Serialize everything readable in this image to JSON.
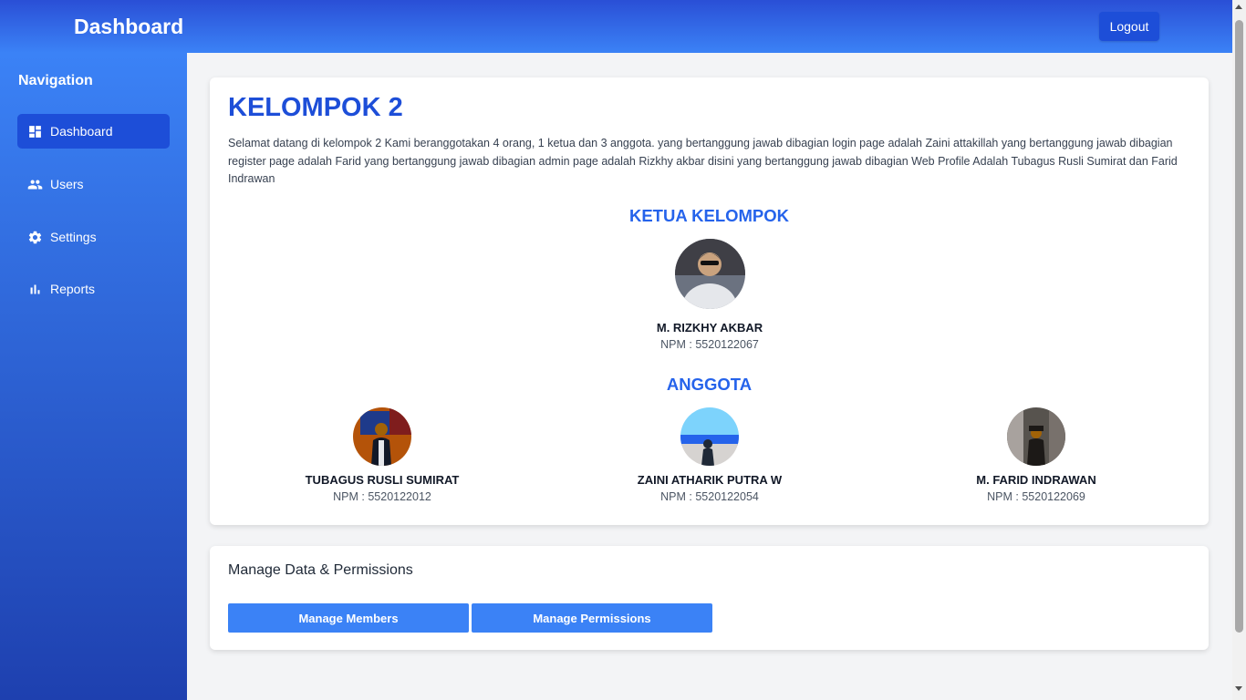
{
  "header": {
    "title": "Dashboard",
    "logout_label": "Logout"
  },
  "sidebar": {
    "heading": "Navigation",
    "items": [
      {
        "label": "Dashboard",
        "icon": "dashboard-icon",
        "active": true
      },
      {
        "label": "Users",
        "icon": "users-icon",
        "active": false
      },
      {
        "label": "Settings",
        "icon": "gear-icon",
        "active": false
      },
      {
        "label": "Reports",
        "icon": "bar-chart-icon",
        "active": false
      }
    ]
  },
  "main": {
    "group_title": "KELOMPOK 2",
    "intro": "Selamat datang di kelompok 2 Kami beranggotakan 4 orang, 1 ketua dan 3 anggota. yang bertanggung jawab dibagian login page adalah Zaini attakillah yang bertanggung jawab dibagian register page adalah Farid yang bertanggung jawab dibagian admin page adalah Rizkhy akbar disini yang bertanggung jawab dibagian Web Profile Adalah Tubagus Rusli Sumirat dan Farid Indrawan",
    "leader_heading": "KETUA KELOMPOK",
    "leader": {
      "name": "M. RIZKHY AKBAR",
      "npm": "NPM : 5520122067"
    },
    "members_heading": "ANGGOTA",
    "members": [
      {
        "name": "TUBAGUS RUSLI SUMIRAT",
        "npm": "NPM : 5520122012"
      },
      {
        "name": "ZAINI ATHARIK PUTRA W",
        "npm": "NPM : 5520122054"
      },
      {
        "name": "M. FARID INDRAWAN",
        "npm": "NPM : 5520122069"
      }
    ]
  },
  "manage": {
    "title": "Manage Data & Permissions",
    "members_button": "Manage Members",
    "permissions_button": "Manage Permissions"
  },
  "colors": {
    "primary": "#1d4ed8",
    "accent": "#3b82f6",
    "heading_blue": "#2563eb"
  }
}
